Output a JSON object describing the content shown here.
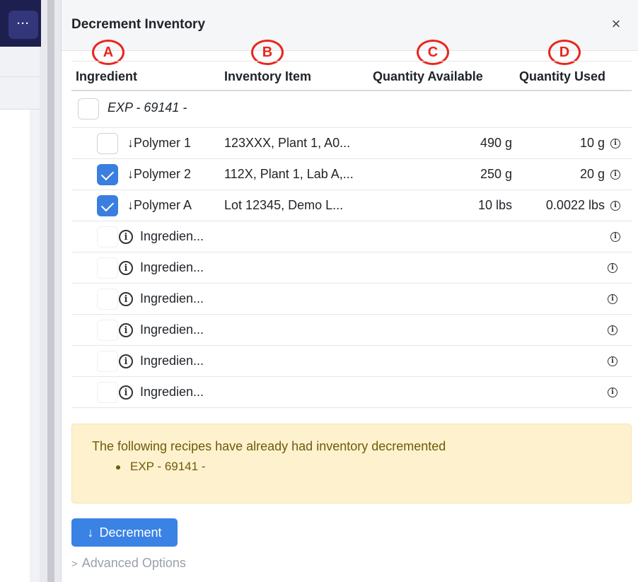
{
  "background": {
    "more_label": "···"
  },
  "panel": {
    "title": "Decrement Inventory",
    "close_label": "×"
  },
  "annotations": [
    "A",
    "B",
    "C",
    "D"
  ],
  "table": {
    "headers": [
      "Ingredient",
      "Inventory Item",
      "Quantity Available",
      "Quantity Used"
    ],
    "group": {
      "label": "EXP - 69141 -"
    },
    "rows": [
      {
        "ingredient": "↓Polymer 1",
        "item": "123XXX, Plant 1, A0...",
        "available": "490 g",
        "used": "10 g",
        "checked": false
      },
      {
        "ingredient": "↓Polymer 2",
        "item": "112X, Plant 1, Lab A,...",
        "available": "250 g",
        "used": "20 g",
        "checked": true
      },
      {
        "ingredient": "↓Polymer A",
        "item": "Lot 12345, Demo L...",
        "available": "10 lbs",
        "used": "0.0022 lbs",
        "checked": true
      }
    ],
    "placeholder_rows": [
      {
        "ingredient": "Ingredien..."
      },
      {
        "ingredient": "Ingredien..."
      },
      {
        "ingredient": "Ingredien..."
      },
      {
        "ingredient": "Ingredien..."
      },
      {
        "ingredient": "Ingredien..."
      },
      {
        "ingredient": "Ingredien..."
      }
    ]
  },
  "warning": {
    "message": "The following recipes have already had inventory decremented",
    "items": [
      "EXP - 69141 -"
    ]
  },
  "actions": {
    "decrement_label": "Decrement",
    "advanced_label": "Advanced Options"
  },
  "colors": {
    "accent": "#3a82e4",
    "annotation": "#e8261c",
    "warning_bg": "#fdf2cd",
    "warning_text": "#6f5a0a"
  }
}
